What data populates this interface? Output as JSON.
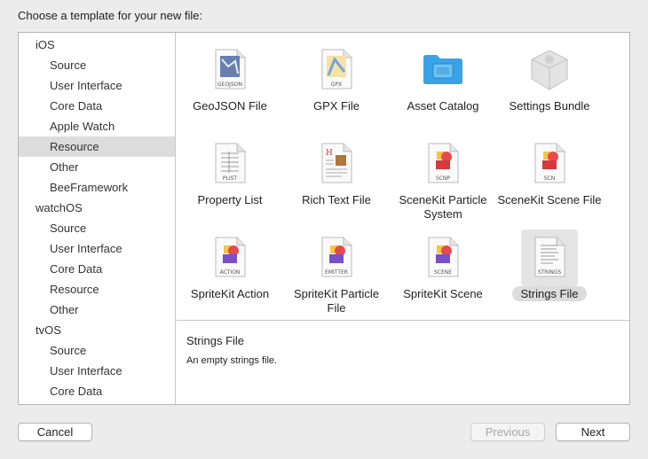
{
  "dialog": {
    "heading": "Choose a template for your new file:"
  },
  "sidebar": {
    "groups": [
      {
        "platform": "iOS",
        "items": [
          "Source",
          "User Interface",
          "Core Data",
          "Apple Watch",
          "Resource",
          "Other",
          "BeeFramework"
        ]
      },
      {
        "platform": "watchOS",
        "items": [
          "Source",
          "User Interface",
          "Core Data",
          "Resource",
          "Other"
        ]
      },
      {
        "platform": "tvOS",
        "items": [
          "Source",
          "User Interface",
          "Core Data"
        ]
      }
    ],
    "selected": "Resource"
  },
  "templates": [
    {
      "name": "GeoJSON File",
      "icon": "geojson-file-icon",
      "badge": "GEOJSON"
    },
    {
      "name": "GPX File",
      "icon": "gpx-file-icon",
      "badge": "GPX"
    },
    {
      "name": "Asset Catalog",
      "icon": "folder-icon",
      "badge": ""
    },
    {
      "name": "Settings Bundle",
      "icon": "settings-bundle-icon",
      "badge": ""
    },
    {
      "name": "Property List",
      "icon": "plist-file-icon",
      "badge": "PLIST"
    },
    {
      "name": "Rich Text File",
      "icon": "rich-text-file-icon",
      "badge": ""
    },
    {
      "name": "SceneKit Particle System",
      "icon": "scenekit-particle-icon",
      "badge": "SCNP"
    },
    {
      "name": "SceneKit Scene File",
      "icon": "scenekit-scene-icon",
      "badge": "SCN"
    },
    {
      "name": "SpriteKit Action",
      "icon": "spritekit-action-icon",
      "badge": "ACTION"
    },
    {
      "name": "SpriteKit Particle File",
      "icon": "spritekit-emitter-icon",
      "badge": "EMITTER"
    },
    {
      "name": "SpriteKit Scene",
      "icon": "spritekit-scene-icon",
      "badge": "SCENE"
    },
    {
      "name": "Strings File",
      "icon": "strings-file-icon",
      "badge": "STRINGS"
    }
  ],
  "selected_template": "Strings File",
  "description": {
    "title": "Strings File",
    "text": "An empty strings file."
  },
  "buttons": {
    "cancel": "Cancel",
    "previous": "Previous",
    "next": "Next"
  },
  "colors": {
    "folder": "#3aa3e8",
    "scenekit_red": "#e54b4b",
    "spritekit_purple": "#7a4fc8",
    "accent_yellow": "#f4c542"
  }
}
